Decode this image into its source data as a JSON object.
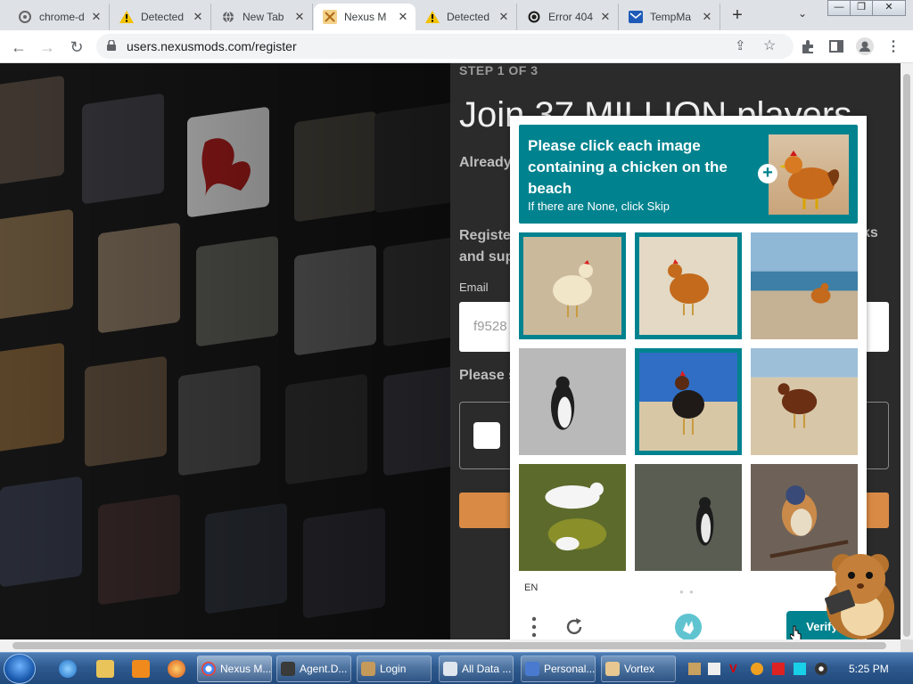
{
  "browser": {
    "tabs": [
      {
        "label": "chrome-d",
        "icon": "gear-icon"
      },
      {
        "label": "Detected",
        "icon": "warning-icon"
      },
      {
        "label": "New Tab",
        "icon": "globe-icon"
      },
      {
        "label": "Nexus M",
        "icon": "nexus-icon"
      },
      {
        "label": "Detected",
        "icon": "warning-icon"
      },
      {
        "label": "Error 404",
        "icon": "shield-icon"
      },
      {
        "label": "TempMa",
        "icon": "mail-icon"
      }
    ],
    "url": "users.nexusmods.com/register"
  },
  "register": {
    "step": "STEP 1 OF 3",
    "heading": "Join 37 MILLION players",
    "already": "Already",
    "register_text": "Register",
    "register_text2": "and sup",
    "register_end": "ks",
    "email_label": "Email",
    "email_value": "f9528",
    "please_solve": "Please s"
  },
  "captcha": {
    "prompt": "Please click each image containing a chicken on the beach",
    "subprompt": "If there are None, click Skip",
    "language": "EN",
    "verify_label": "Verify",
    "cells": [
      {
        "subject": "chicken",
        "selected": true
      },
      {
        "subject": "chicken",
        "selected": true
      },
      {
        "subject": "chicken-beach",
        "selected": false
      },
      {
        "subject": "penguin",
        "selected": false
      },
      {
        "subject": "rooster-beach",
        "selected": true
      },
      {
        "subject": "chicken-beach",
        "selected": false
      },
      {
        "subject": "ducks",
        "selected": false
      },
      {
        "subject": "penguin",
        "selected": false
      },
      {
        "subject": "bird",
        "selected": false
      }
    ]
  },
  "taskbar": {
    "buttons": [
      "Nexus M...",
      "Agent.D...",
      "Login",
      "All Data ...",
      "Personal...",
      "Vortex"
    ],
    "clock": "5:25 PM"
  },
  "colors": {
    "accent": "#00838f",
    "orange": "#d98b45"
  }
}
